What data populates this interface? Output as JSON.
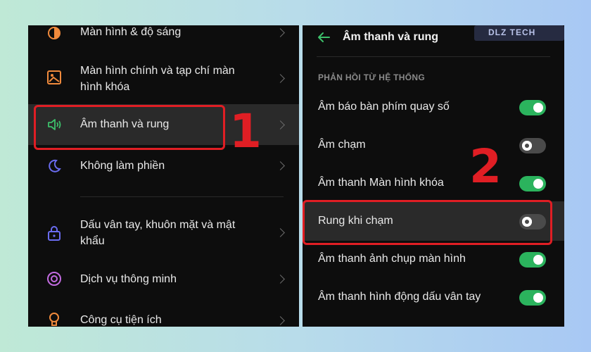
{
  "left": {
    "items": [
      {
        "label": "Màn hình & độ sáng",
        "icon": "brightness-icon"
      },
      {
        "label": "Màn hình chính và tạp chí màn hình khóa",
        "icon": "home-screen-icon"
      },
      {
        "label": "Âm thanh và rung",
        "icon": "speaker-icon"
      },
      {
        "label": "Không làm phiền",
        "icon": "moon-icon"
      },
      {
        "label": "Dấu vân tay, khuôn mặt và mật khẩu",
        "icon": "lock-icon"
      },
      {
        "label": "Dịch vụ thông minh",
        "icon": "smart-services-icon"
      },
      {
        "label": "Công cụ tiện ích",
        "icon": "tools-icon"
      }
    ],
    "callout_number": "1"
  },
  "right": {
    "title": "Âm thanh và rung",
    "section_header": "PHẢN HỒI TỪ HỆ THỐNG",
    "watermark": "DLZ TECH",
    "items": [
      {
        "label": "Âm báo bàn phím quay số",
        "on": true
      },
      {
        "label": "Âm chạm",
        "on": false
      },
      {
        "label": "Âm thanh Màn hình khóa",
        "on": true
      },
      {
        "label": "Rung khi chạm",
        "on": false
      },
      {
        "label": "Âm thanh ảnh chụp màn hình",
        "on": true
      },
      {
        "label": "Âm thanh hình động dấu vân tay",
        "on": true
      }
    ],
    "callout_number": "2"
  },
  "colors": {
    "accent_green": "#2bb35d",
    "callout_red": "#e01e24"
  }
}
